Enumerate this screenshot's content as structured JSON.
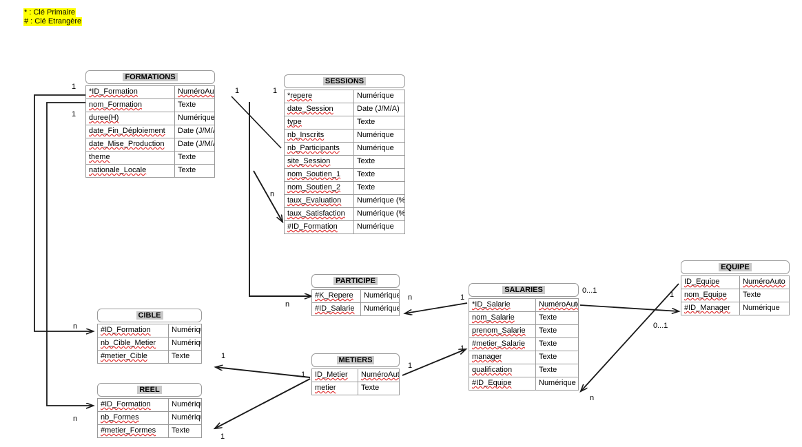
{
  "legend": {
    "line1": "* : Clé Primaire",
    "line2": "# : Clé Etrangère",
    "highlight_color": "#ffff00"
  },
  "entities": {
    "formations": {
      "title": "FORMATIONS",
      "rows": [
        {
          "field": "*ID_Formation",
          "type": "NuméroAuto"
        },
        {
          "field": "nom_Formation",
          "type": "Texte"
        },
        {
          "field": "duree(H)",
          "type": "Numérique"
        },
        {
          "field": "date_Fin_Déploiement",
          "type": "Date (J/M/A)"
        },
        {
          "field": "date_Mise_Production",
          "type": "Date (J/M/A)"
        },
        {
          "field": "theme",
          "type": "Texte"
        },
        {
          "field": "nationale_Locale",
          "type": "Texte"
        }
      ]
    },
    "sessions": {
      "title": "SESSIONS",
      "rows": [
        {
          "field": "*repere",
          "type": "Numérique"
        },
        {
          "field": "date_Session",
          "type": "Date (J/M/A)"
        },
        {
          "field": "type",
          "type": "Texte"
        },
        {
          "field": "nb_Inscrits",
          "type": "Numérique"
        },
        {
          "field": "nb_Participants",
          "type": "Numérique"
        },
        {
          "field": "site_Session",
          "type": "Texte"
        },
        {
          "field": "nom_Soutien_1",
          "type": "Texte"
        },
        {
          "field": "nom_Soutien_2",
          "type": "Texte"
        },
        {
          "field": "taux_Evaluation",
          "type": "Numérique (%)"
        },
        {
          "field": "taux_Satisfaction",
          "type": "Numérique (%)"
        },
        {
          "field": "#ID_Formation",
          "type": "Numérique"
        }
      ]
    },
    "participe": {
      "title": "PARTICIPE",
      "rows": [
        {
          "field": "#K_Repere",
          "type": "Numérique"
        },
        {
          "field": "#ID_Salarie",
          "type": "Numérique"
        }
      ]
    },
    "salaries": {
      "title": "SALARIES",
      "rows": [
        {
          "field": "*ID_Salarie",
          "type": "NuméroAuto"
        },
        {
          "field": "nom_Salarie",
          "type": "Texte"
        },
        {
          "field": "prenom_Salarie",
          "type": "Texte"
        },
        {
          "field": "#metier_Salarie",
          "type": "Texte"
        },
        {
          "field": "manager",
          "type": "Texte"
        },
        {
          "field": "qualification",
          "type": "Texte"
        },
        {
          "field": "#ID_Equipe",
          "type": "Numérique"
        }
      ]
    },
    "equipe": {
      "title": "EQUIPE",
      "rows": [
        {
          "field": "ID_Equipe",
          "type": "NuméroAuto"
        },
        {
          "field": "nom_Equipe",
          "type": "Texte"
        },
        {
          "field": "#ID_Manager",
          "type": "Numérique"
        }
      ]
    },
    "cible": {
      "title": "CIBLE",
      "rows": [
        {
          "field": "#ID_Formation",
          "type": "Numérique"
        },
        {
          "field": "nb_Cible_Metier",
          "type": "Numérique"
        },
        {
          "field": "#metier_Cible",
          "type": "Texte"
        }
      ]
    },
    "reel": {
      "title": "REEL",
      "rows": [
        {
          "field": "#ID_Formation",
          "type": "Numérique"
        },
        {
          "field": "nb_Formes",
          "type": "Numérique"
        },
        {
          "field": "#metier_Formes",
          "type": "Texte"
        }
      ]
    },
    "metiers": {
      "title": "METIERS",
      "rows": [
        {
          "field": "ID_Metier",
          "type": "NuméroAuto"
        },
        {
          "field": "metier",
          "type": "Texte"
        }
      ]
    }
  },
  "cardinalities": [
    {
      "id": "c-formations-cible-1",
      "label": "1"
    },
    {
      "id": "c-formations-reel-1",
      "label": "1"
    },
    {
      "id": "c-cible-n",
      "label": "n"
    },
    {
      "id": "c-reel-n",
      "label": "n"
    },
    {
      "id": "c-formations-sessions-1",
      "label": "1"
    },
    {
      "id": "c-sessions-1",
      "label": "1"
    },
    {
      "id": "c-sessions-n",
      "label": "n"
    },
    {
      "id": "c-participe-n",
      "label": "n"
    },
    {
      "id": "c-participe-right-n",
      "label": "n"
    },
    {
      "id": "c-salaries-1",
      "label": "1"
    },
    {
      "id": "c-salaries-equipe-01",
      "label": "0...1"
    },
    {
      "id": "c-equipe-manager-01",
      "label": "0...1"
    },
    {
      "id": "c-equipe-1",
      "label": "1"
    },
    {
      "id": "c-salaries-equipe-n",
      "label": "n"
    },
    {
      "id": "c-metiers-cible-1",
      "label": "1"
    },
    {
      "id": "c-metiers-reel-1",
      "label": "1"
    },
    {
      "id": "c-metiers-left-1",
      "label": "1"
    },
    {
      "id": "c-metiers-salaries-1",
      "label": "1"
    },
    {
      "id": "c-salaries-metier-1",
      "label": "1"
    }
  ],
  "colors": {
    "border": "#9a9a9a",
    "caption_highlight": "#c8c8c8",
    "spellcheck_underline": "#e03030",
    "connector": "#1a1a1a"
  }
}
